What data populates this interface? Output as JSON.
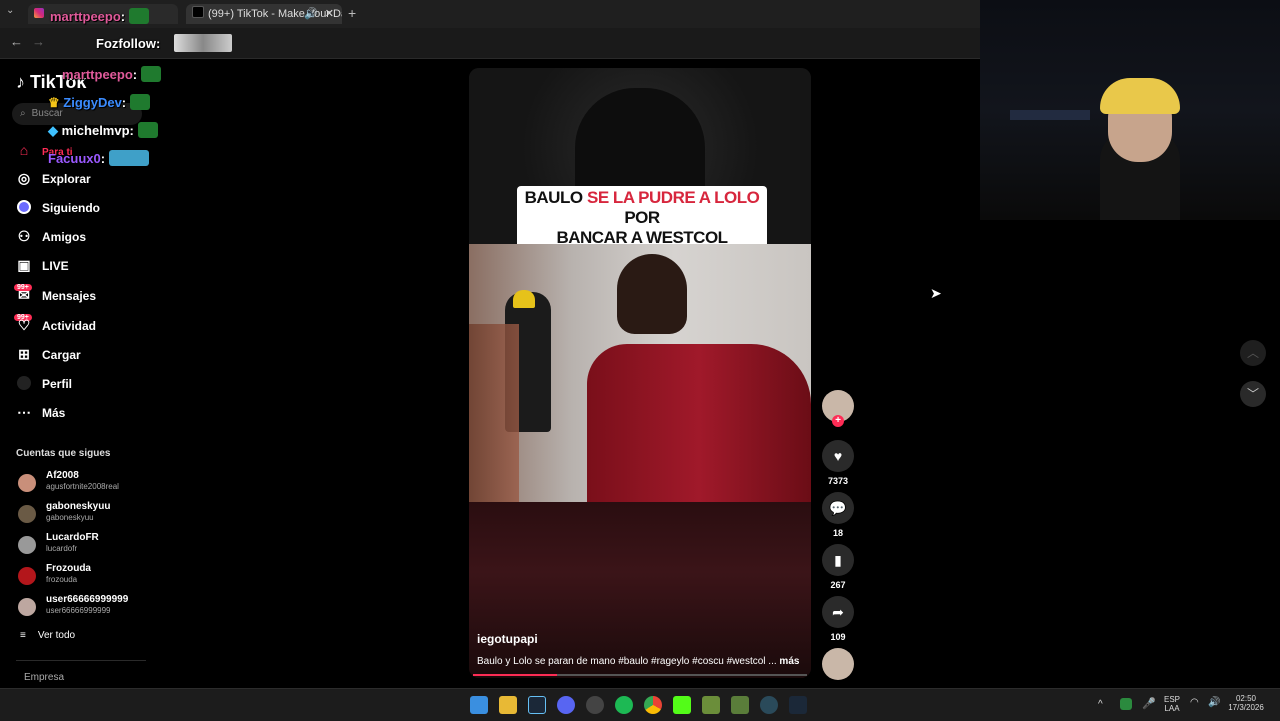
{
  "browser": {
    "tabs": [
      {
        "label": "",
        "icon": "instagram-icon"
      },
      {
        "label": "(99+) TikTok - Make Your Da",
        "icon": "tiktok-icon"
      }
    ],
    "new_tab": "+"
  },
  "chat_overlay": [
    {
      "user": "marttpeepo",
      "color": "#e05a9a"
    },
    {
      "user": "Fozfollow",
      "color": "#ffffff"
    },
    {
      "user": "marttpeepo",
      "color": "#e05a9a"
    },
    {
      "user": "ZiggyDev",
      "color": "#3b8cff"
    },
    {
      "user": "michelmvp",
      "color": "#ffffff"
    },
    {
      "user": "Facuux0",
      "color": "#9b59ff"
    }
  ],
  "sidebar": {
    "logo": "TikTok",
    "search_placeholder": "Buscar",
    "nav": [
      {
        "label": "Para ti",
        "icon": "home-icon"
      },
      {
        "label": "Explorar",
        "icon": "compass-icon"
      },
      {
        "label": "Siguiendo",
        "icon": "following-icon"
      },
      {
        "label": "Amigos",
        "icon": "friends-icon"
      },
      {
        "label": "LIVE",
        "icon": "live-icon"
      },
      {
        "label": "Mensajes",
        "icon": "message-icon",
        "badge": "99+"
      },
      {
        "label": "Actividad",
        "icon": "activity-icon",
        "badge": "99+"
      },
      {
        "label": "Cargar",
        "icon": "upload-icon"
      },
      {
        "label": "Perfil",
        "icon": "profile-icon"
      },
      {
        "label": "Más",
        "icon": "more-icon"
      }
    ],
    "following_title": "Cuentas que sigues",
    "accounts": [
      {
        "name": "Af2008",
        "handle": "agusfortnite2008real"
      },
      {
        "name": "gaboneskyuu",
        "handle": "gaboneskyuu"
      },
      {
        "name": "LucardoFR",
        "handle": "lucardofr"
      },
      {
        "name": "Frozouda",
        "handle": "frozouda"
      },
      {
        "name": "user66666999999",
        "handle": "user66666999999"
      }
    ],
    "see_all": "Ver todo",
    "company": "Empresa"
  },
  "video": {
    "caption_parts": [
      "BAULO",
      "SE LA PUDRE A LOLO",
      "POR",
      "BANCAR A WESTCOL"
    ],
    "username": "iegotupapi",
    "description": "Baulo y Lolo se paran de mano #baulo #rageylo #coscu #westcol ...",
    "more": "más",
    "progress": 0.25
  },
  "actions": {
    "likes": "7373",
    "comments": "18",
    "saves": "267",
    "shares": "109"
  },
  "taskbar": {
    "lang_top": "ESP",
    "lang_bottom": "LAA",
    "time": "02:50",
    "date": "17/3/2026"
  }
}
